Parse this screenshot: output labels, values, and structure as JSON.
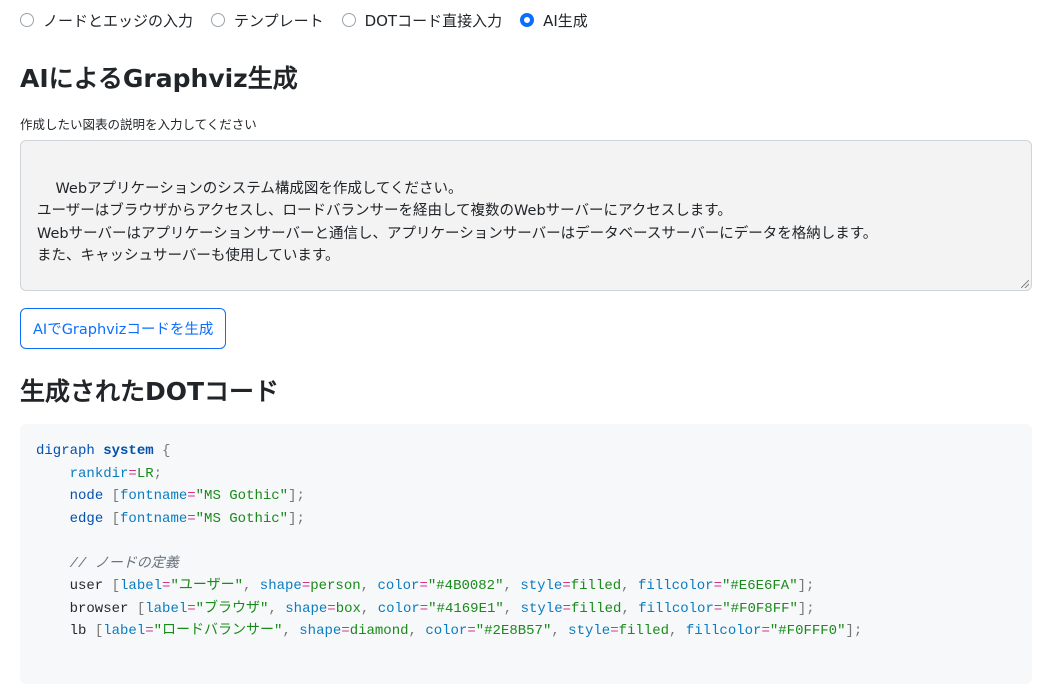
{
  "input_modes": [
    {
      "label": "ノードとエッジの入力",
      "checked": false
    },
    {
      "label": "テンプレート",
      "checked": false
    },
    {
      "label": "DOTコード直接入力",
      "checked": false
    },
    {
      "label": "AI生成",
      "checked": true
    }
  ],
  "ai_section": {
    "title": "AIによるGraphviz生成",
    "description_label": "作成したい図表の説明を入力してください",
    "description_value": "Webアプリケーションのシステム構成図を作成してください。\nユーザーはブラウザからアクセスし、ロードバランサーを経由して複数のWebサーバーにアクセスします。\nWebサーバーはアプリケーションサーバーと通信し、アプリケーションサーバーはデータベースサーバーにデータを格納します。\nまた、キャッシュサーバーも使用しています。",
    "generate_button": "AIでGraphvizコードを生成"
  },
  "output_section": {
    "title": "生成されたDOTコード",
    "code_lines": [
      [
        {
          "t": "digraph ",
          "c": "kw"
        },
        {
          "t": "system",
          "c": "kwb"
        },
        {
          "t": " {",
          "c": "pun"
        }
      ],
      [
        {
          "t": "    ",
          "c": "id"
        },
        {
          "t": "rankdir",
          "c": "attr"
        },
        {
          "t": "=",
          "c": "op"
        },
        {
          "t": "LR",
          "c": "val"
        },
        {
          "t": ";",
          "c": "pun"
        }
      ],
      [
        {
          "t": "    ",
          "c": "id"
        },
        {
          "t": "node",
          "c": "kw"
        },
        {
          "t": " [",
          "c": "pun"
        },
        {
          "t": "fontname",
          "c": "attr"
        },
        {
          "t": "=",
          "c": "op"
        },
        {
          "t": "\"MS Gothic\"",
          "c": "str"
        },
        {
          "t": "];",
          "c": "pun"
        }
      ],
      [
        {
          "t": "    ",
          "c": "id"
        },
        {
          "t": "edge",
          "c": "kw"
        },
        {
          "t": " [",
          "c": "pun"
        },
        {
          "t": "fontname",
          "c": "attr"
        },
        {
          "t": "=",
          "c": "op"
        },
        {
          "t": "\"MS Gothic\"",
          "c": "str"
        },
        {
          "t": "];",
          "c": "pun"
        }
      ],
      [
        {
          "t": "",
          "c": "id"
        }
      ],
      [
        {
          "t": "    // ノードの定義",
          "c": "com"
        }
      ],
      [
        {
          "t": "    user ",
          "c": "id"
        },
        {
          "t": "[",
          "c": "pun"
        },
        {
          "t": "label",
          "c": "attr"
        },
        {
          "t": "=",
          "c": "op"
        },
        {
          "t": "\"ユーザー\"",
          "c": "str"
        },
        {
          "t": ", ",
          "c": "pun"
        },
        {
          "t": "shape",
          "c": "attr"
        },
        {
          "t": "=",
          "c": "op"
        },
        {
          "t": "person",
          "c": "val"
        },
        {
          "t": ", ",
          "c": "pun"
        },
        {
          "t": "color",
          "c": "attr"
        },
        {
          "t": "=",
          "c": "op"
        },
        {
          "t": "\"#4B0082\"",
          "c": "str"
        },
        {
          "t": ", ",
          "c": "pun"
        },
        {
          "t": "style",
          "c": "attr"
        },
        {
          "t": "=",
          "c": "op"
        },
        {
          "t": "filled",
          "c": "val"
        },
        {
          "t": ", ",
          "c": "pun"
        },
        {
          "t": "fillcolor",
          "c": "attr"
        },
        {
          "t": "=",
          "c": "op"
        },
        {
          "t": "\"#E6E6FA\"",
          "c": "str"
        },
        {
          "t": "];",
          "c": "pun"
        }
      ],
      [
        {
          "t": "    browser ",
          "c": "id"
        },
        {
          "t": "[",
          "c": "pun"
        },
        {
          "t": "label",
          "c": "attr"
        },
        {
          "t": "=",
          "c": "op"
        },
        {
          "t": "\"ブラウザ\"",
          "c": "str"
        },
        {
          "t": ", ",
          "c": "pun"
        },
        {
          "t": "shape",
          "c": "attr"
        },
        {
          "t": "=",
          "c": "op"
        },
        {
          "t": "box",
          "c": "val"
        },
        {
          "t": ", ",
          "c": "pun"
        },
        {
          "t": "color",
          "c": "attr"
        },
        {
          "t": "=",
          "c": "op"
        },
        {
          "t": "\"#4169E1\"",
          "c": "str"
        },
        {
          "t": ", ",
          "c": "pun"
        },
        {
          "t": "style",
          "c": "attr"
        },
        {
          "t": "=",
          "c": "op"
        },
        {
          "t": "filled",
          "c": "val"
        },
        {
          "t": ", ",
          "c": "pun"
        },
        {
          "t": "fillcolor",
          "c": "attr"
        },
        {
          "t": "=",
          "c": "op"
        },
        {
          "t": "\"#F0F8FF\"",
          "c": "str"
        },
        {
          "t": "];",
          "c": "pun"
        }
      ],
      [
        {
          "t": "    lb ",
          "c": "id"
        },
        {
          "t": "[",
          "c": "pun"
        },
        {
          "t": "label",
          "c": "attr"
        },
        {
          "t": "=",
          "c": "op"
        },
        {
          "t": "\"ロードバランサー\"",
          "c": "str"
        },
        {
          "t": ", ",
          "c": "pun"
        },
        {
          "t": "shape",
          "c": "attr"
        },
        {
          "t": "=",
          "c": "op"
        },
        {
          "t": "diamond",
          "c": "val"
        },
        {
          "t": ", ",
          "c": "pun"
        },
        {
          "t": "color",
          "c": "attr"
        },
        {
          "t": "=",
          "c": "op"
        },
        {
          "t": "\"#2E8B57\"",
          "c": "str"
        },
        {
          "t": ", ",
          "c": "pun"
        },
        {
          "t": "style",
          "c": "attr"
        },
        {
          "t": "=",
          "c": "op"
        },
        {
          "t": "filled",
          "c": "val"
        },
        {
          "t": ", ",
          "c": "pun"
        },
        {
          "t": "fillcolor",
          "c": "attr"
        },
        {
          "t": "=",
          "c": "op"
        },
        {
          "t": "\"#F0FFF0\"",
          "c": "str"
        },
        {
          "t": "];",
          "c": "pun"
        }
      ]
    ]
  },
  "colors": {
    "accent": "#0d6efd",
    "textarea_bg": "#f3f3f3",
    "code_bg": "#f6f8fa"
  }
}
